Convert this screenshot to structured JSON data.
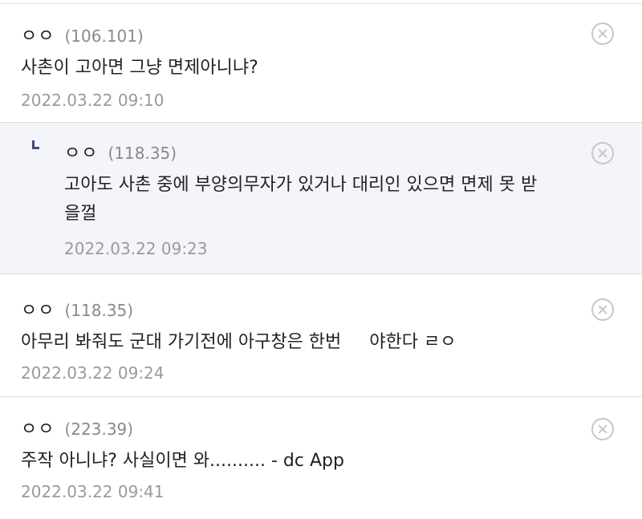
{
  "comments": [
    {
      "nickname": "ㅇㅇ",
      "ip": "(106.101)",
      "text_lines": [
        "사촌이 고아면 그냥 면제아니냐?"
      ],
      "date": "2022.03.22 09:10",
      "is_reply": false
    },
    {
      "nickname": "ㅇㅇ",
      "ip": "(118.35)",
      "text_lines": [
        "고아도 사촌 중에 부양의무자가 있거나 대리인 있으면 면제 못 받",
        "을껄"
      ],
      "date": "2022.03.22 09:23",
      "is_reply": true
    },
    {
      "nickname": "ㅇㅇ",
      "ip": "(118.35)",
      "text_lines": [
        "아무리 봐줘도 군대 가기전에 아구창은 한번     야한다 ㄹㅇ"
      ],
      "date": "2022.03.22 09:24",
      "is_reply": false
    },
    {
      "nickname": "ㅇㅇ",
      "ip": "(223.39)",
      "text_lines": [
        "주작 아니냐? 사실이면 와.......... - dc App"
      ],
      "date": "2022.03.22 09:41",
      "is_reply": false
    }
  ],
  "colors": {
    "reply_background": "#f4f5fa",
    "reply_arrow": "#3b4a88",
    "divider": "#dcdcdc",
    "muted_text": "#9a9a9a"
  },
  "icons": {
    "delete": "close-circle-icon",
    "reply": "reply-arrow-icon"
  }
}
